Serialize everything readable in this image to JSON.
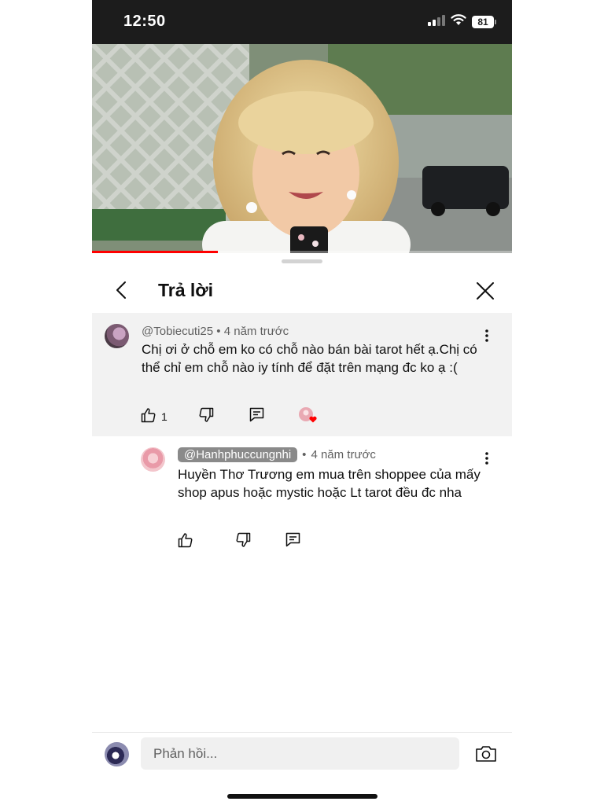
{
  "status_bar": {
    "time": "12:50",
    "battery_level": "81",
    "icons": [
      "cellular-signal-icon",
      "wifi-icon",
      "battery-icon"
    ]
  },
  "video": {
    "progress_fraction": 0.3,
    "progress_color": "#ff0000"
  },
  "sheet": {
    "title": "Trả lời",
    "icons": [
      "back-chevron-icon",
      "close-x-icon"
    ]
  },
  "parent_comment": {
    "author": "@Tobiecuti25",
    "separator": " • ",
    "time_ago": "4 năm trước",
    "text": "Chị ơi ở chỗ em ko có chỗ nào bán bài tarot hết ạ.Chị có thể chỉ em chỗ nào iy tính để đặt trên mạng đc ko ạ :(",
    "like_count": "1",
    "icons": [
      "thumbs-up-icon",
      "thumbs-down-icon",
      "reply-comment-icon",
      "creator-heart-icon",
      "more-vertical-icon"
    ]
  },
  "reply": {
    "author": "@Hanhphuccungnhi",
    "separator": "•",
    "time_ago": "4 năm trước",
    "text": "Huyền Thơ Trương em mua trên shoppee của mấy shop apus hoặc mystic hoặc Lt tarot đều đc nha",
    "icons": [
      "thumbs-up-icon",
      "thumbs-down-icon",
      "reply-comment-icon",
      "more-vertical-icon"
    ]
  },
  "composer": {
    "placeholder": "Phản hồi...",
    "icons": [
      "camera-icon"
    ]
  },
  "colors": {
    "accent_red": "#ff0000",
    "text_primary": "#0f0f0f",
    "text_secondary": "#606060",
    "highlight_bg": "#f2f2f2"
  }
}
